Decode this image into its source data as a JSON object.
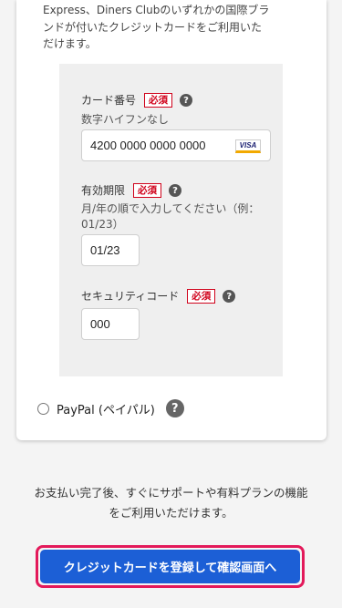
{
  "intro": {
    "line1": "Express、Diners Clubのいずれかの国際ブラ",
    "line2": "ンドが付いたクレジットカードをご利用いた",
    "line3": "だけます。"
  },
  "card_number": {
    "label": "カード番号",
    "required_badge": "必須",
    "help_icon": "?",
    "hint": "数字ハイフンなし",
    "value": "4200 0000 0000 0000",
    "brand_icon": "VISA"
  },
  "expiry": {
    "label": "有効期限",
    "required_badge": "必須",
    "help_icon": "?",
    "hint_line1": "月/年の順で入力してください（例：",
    "hint_line2": "01/23）",
    "value": "01/23"
  },
  "security_code": {
    "label": "セキュリティコード",
    "required_badge": "必須",
    "help_icon": "?",
    "value": "000"
  },
  "paypal": {
    "label": "PayPal (ペイパル)",
    "help_icon": "?"
  },
  "notice": {
    "line1": "お支払い完了後、すぐにサポートや有料プランの機能",
    "line2": "をご利用いただけます。"
  },
  "cta": {
    "label": "クレジットカードを登録して確認画面へ"
  }
}
